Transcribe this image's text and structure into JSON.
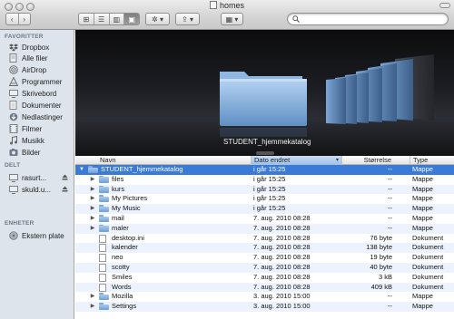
{
  "window": {
    "title": "homes"
  },
  "toolbar": {
    "nav": [
      "‹",
      "›"
    ],
    "view_modes": [
      "⊞",
      "☰",
      "▥",
      "▣"
    ],
    "action_label": "✲ ▾",
    "share_label": "⇪ ▾",
    "arrange_label": "▦ ▾",
    "search_placeholder": ""
  },
  "sidebar": {
    "favorites_heading": "FAVORITTER",
    "favorites": [
      "Dropbox",
      "Alle filer",
      "AirDrop",
      "Programmer",
      "Skrivebord",
      "Dokumenter",
      "Nedlastinger",
      "Filmer",
      "Musikk",
      "Bilder"
    ],
    "shared_heading": "DELT",
    "shared": [
      "rasurt...",
      "skuld.u..."
    ],
    "devices_heading": "ENHETER",
    "devices": [
      "Ekstern plate"
    ]
  },
  "coverflow": {
    "caption": "STUDENT_hjemmekatalog"
  },
  "columns": {
    "name": "Navn",
    "date": "Dato endret",
    "size": "Størrelse",
    "kind": "Type"
  },
  "rows": [
    {
      "name": "STUDENT_hjemmekatalog",
      "date": "i går 15:25",
      "size": "--",
      "kind": "Mappe",
      "icon": "folder-icon",
      "expanded": true,
      "level": 0
    },
    {
      "name": "files",
      "date": "i går 15:25",
      "size": "--",
      "kind": "Mappe",
      "icon": "folder-icon",
      "expanded": false,
      "level": 1
    },
    {
      "name": "kurs",
      "date": "i går 15:25",
      "size": "--",
      "kind": "Mappe",
      "icon": "folder-icon",
      "expanded": false,
      "level": 1
    },
    {
      "name": "My Pictures",
      "date": "i går 15:25",
      "size": "--",
      "kind": "Mappe",
      "icon": "folder-icon",
      "expanded": false,
      "level": 1
    },
    {
      "name": "My Music",
      "date": "i går 15:25",
      "size": "--",
      "kind": "Mappe",
      "icon": "folder-icon",
      "expanded": false,
      "level": 1
    },
    {
      "name": "mail",
      "date": "7. aug. 2010 08:28",
      "size": "--",
      "kind": "Mappe",
      "icon": "folder-icon",
      "expanded": false,
      "level": 1
    },
    {
      "name": "maler",
      "date": "7. aug. 2010 08:28",
      "size": "--",
      "kind": "Mappe",
      "icon": "folder-icon",
      "expanded": false,
      "level": 1
    },
    {
      "name": "desktop.ini",
      "date": "7. aug. 2010 08:28",
      "size": "76 byte",
      "kind": "Dokument",
      "icon": "document-icon",
      "level": 1
    },
    {
      "name": "kalender",
      "date": "7. aug. 2010 08:28",
      "size": "138 byte",
      "kind": "Dokument",
      "icon": "document-icon",
      "level": 1
    },
    {
      "name": "neo",
      "date": "7. aug. 2010 08:28",
      "size": "19 byte",
      "kind": "Dokument",
      "icon": "document-icon",
      "level": 1
    },
    {
      "name": "scotty",
      "date": "7. aug. 2010 08:28",
      "size": "40 byte",
      "kind": "Dokument",
      "icon": "document-icon",
      "level": 1
    },
    {
      "name": "Smiles",
      "date": "7. aug. 2010 08:28",
      "size": "3 kB",
      "kind": "Dokument",
      "icon": "document-icon",
      "level": 1
    },
    {
      "name": "Words",
      "date": "7. aug. 2010 08:28",
      "size": "409 kB",
      "kind": "Dokument",
      "icon": "document-icon",
      "level": 1
    },
    {
      "name": "Mozilla",
      "date": "3. aug. 2010 15:00",
      "size": "--",
      "kind": "Mappe",
      "icon": "folder-icon",
      "expanded": false,
      "level": 1
    },
    {
      "name": "Settings",
      "date": "3. aug. 2010 15:00",
      "size": "--",
      "kind": "Mappe",
      "icon": "folder-icon",
      "expanded": false,
      "level": 1
    }
  ],
  "colors": {
    "selection": "#3b7bd8",
    "sidebar_bg": "#dde4ec",
    "alt_row": "#edf3fe"
  }
}
